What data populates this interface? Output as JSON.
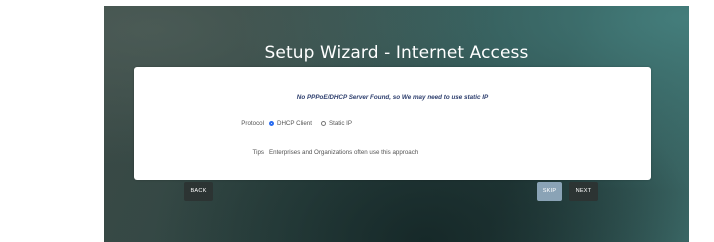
{
  "wizard": {
    "title": "Setup Wizard - Internet Access"
  },
  "notice": "No PPPoE/DHCP Server Found, so We may need to use static IP",
  "protocol": {
    "label": "Protocol",
    "options": [
      {
        "label": "DHCP Client",
        "selected": true
      },
      {
        "label": "Static IP",
        "selected": false
      }
    ]
  },
  "tips": {
    "label": "Tips",
    "text": "Enterprises and Organizations often use this approach"
  },
  "buttons": {
    "back": "BACK",
    "skip": "SKIP",
    "next": "NEXT"
  },
  "colors": {
    "radio_selected": "#2a6df0",
    "notice_text": "#2e3f6e",
    "skip_button": "#8aa3b6",
    "dark_button": "#2c3433"
  }
}
